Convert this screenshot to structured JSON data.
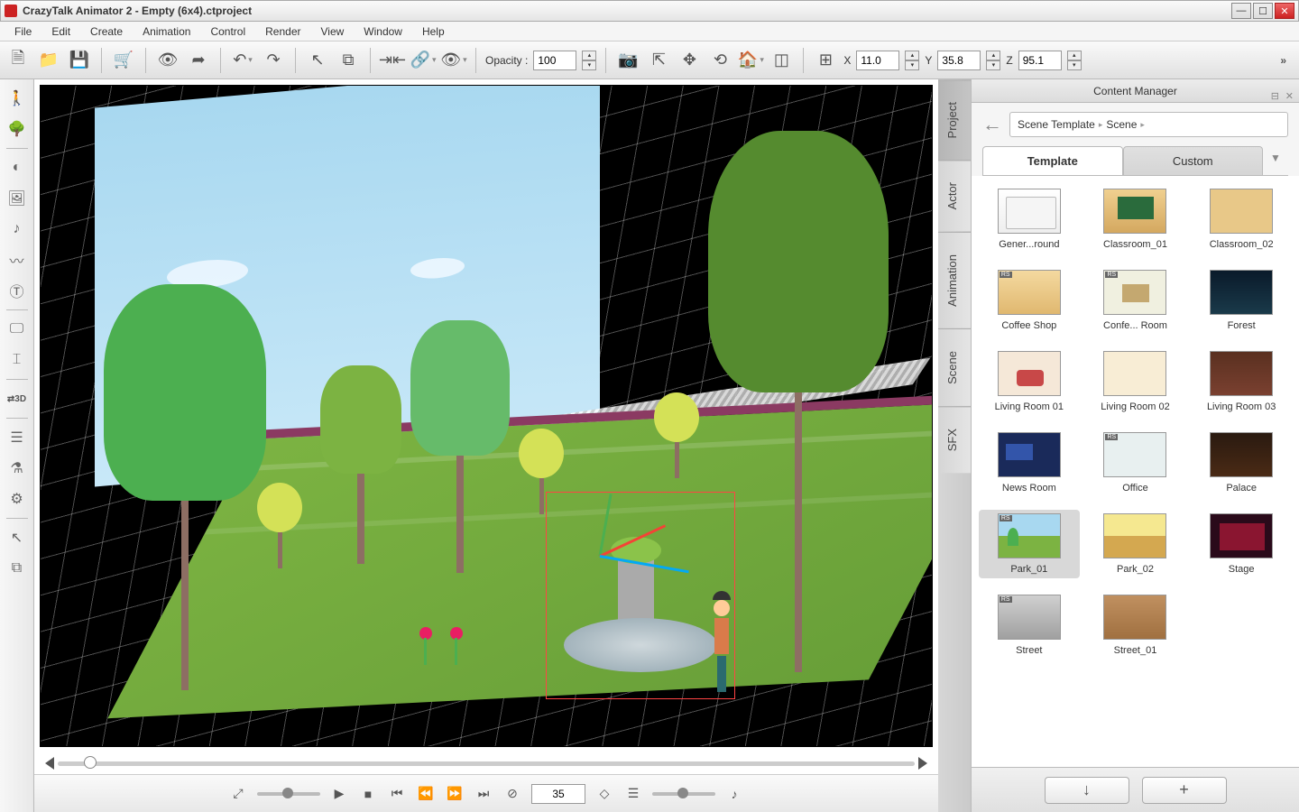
{
  "window": {
    "title": "CrazyTalk Animator 2   -  Empty  (6x4).ctproject"
  },
  "menu": [
    "File",
    "Edit",
    "Create",
    "Animation",
    "Control",
    "Render",
    "View",
    "Window",
    "Help"
  ],
  "toolbar": {
    "opacity_label": "Opacity :",
    "opacity_value": "100",
    "x_label": "X",
    "x_value": "11.0",
    "y_label": "Y",
    "y_value": "35.8",
    "z_label": "Z",
    "z_value": "95.1"
  },
  "playback": {
    "frame": "35"
  },
  "content_manager": {
    "title": "Content Manager",
    "breadcrumb": [
      "Scene Template",
      "Scene"
    ],
    "tabs": {
      "template": "Template",
      "custom": "Custom"
    },
    "footer": {
      "download": "↓",
      "add": "+"
    }
  },
  "side_tabs": [
    "Project",
    "Actor",
    "Animation",
    "Scene",
    "SFX"
  ],
  "scenes": [
    {
      "label": "Gener...round",
      "cls": "th-folder",
      "rs": false
    },
    {
      "label": "Classroom_01",
      "cls": "th-class",
      "rs": false
    },
    {
      "label": "Classroom_02",
      "cls": "th-class2",
      "rs": false
    },
    {
      "label": "Coffee Shop",
      "cls": "th-coffee",
      "rs": true
    },
    {
      "label": "Confe... Room",
      "cls": "th-conf",
      "rs": true
    },
    {
      "label": "Forest",
      "cls": "th-forest",
      "rs": false
    },
    {
      "label": "Living Room 01",
      "cls": "th-lr1",
      "rs": false
    },
    {
      "label": "Living Room 02",
      "cls": "th-lr2",
      "rs": false
    },
    {
      "label": "Living Room 03",
      "cls": "th-lr3",
      "rs": false
    },
    {
      "label": "News Room",
      "cls": "th-news",
      "rs": false
    },
    {
      "label": "Office",
      "cls": "th-office",
      "rs": true
    },
    {
      "label": "Palace",
      "cls": "th-palace",
      "rs": false
    },
    {
      "label": "Park_01",
      "cls": "th-park1",
      "rs": true,
      "selected": true
    },
    {
      "label": "Park_02",
      "cls": "th-park2",
      "rs": false
    },
    {
      "label": "Stage",
      "cls": "th-stage",
      "rs": false
    },
    {
      "label": "Street",
      "cls": "th-street",
      "rs": true
    },
    {
      "label": "Street_01",
      "cls": "th-street1",
      "rs": false
    }
  ]
}
